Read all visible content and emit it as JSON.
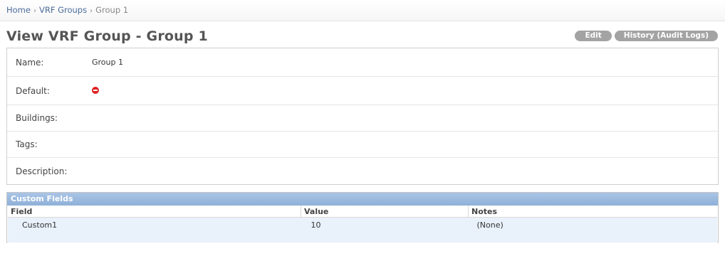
{
  "breadcrumb": {
    "items": [
      "Home",
      "VRF Groups"
    ],
    "separator": "›",
    "current": "Group 1"
  },
  "page": {
    "title": "View VRF Group - Group 1"
  },
  "actions": {
    "edit": "Edit",
    "history": "History (Audit Logs)"
  },
  "details": {
    "fields": [
      {
        "label": "Name:",
        "value": "Group 1"
      },
      {
        "label": "Default:",
        "value": "",
        "icon": "no-entry-icon"
      },
      {
        "label": "Buildings:",
        "value": ""
      },
      {
        "label": "Tags:",
        "value": ""
      },
      {
        "label": "Description:",
        "value": ""
      }
    ]
  },
  "custom_fields": {
    "title": "Custom Fields",
    "columns": [
      "Field",
      "Value",
      "Notes"
    ],
    "rows": [
      {
        "field": "Custom1",
        "value": "10",
        "notes": "(None)"
      }
    ]
  },
  "colors": {
    "link": "#4a6c9b",
    "button": "#a3a3a3",
    "panel_header": "#9bbce0",
    "row_bg": "#e9f1fb",
    "no_icon": "#dd2222"
  }
}
